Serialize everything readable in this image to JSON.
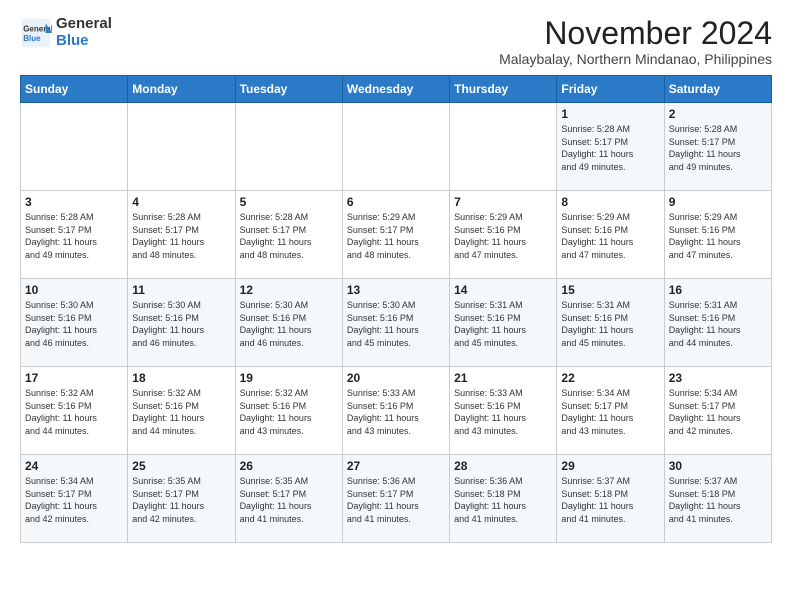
{
  "header": {
    "logo_line1": "General",
    "logo_line2": "Blue",
    "month": "November 2024",
    "location": "Malaybalay, Northern Mindanao, Philippines"
  },
  "days_of_week": [
    "Sunday",
    "Monday",
    "Tuesday",
    "Wednesday",
    "Thursday",
    "Friday",
    "Saturday"
  ],
  "weeks": [
    [
      {
        "day": "",
        "info": ""
      },
      {
        "day": "",
        "info": ""
      },
      {
        "day": "",
        "info": ""
      },
      {
        "day": "",
        "info": ""
      },
      {
        "day": "",
        "info": ""
      },
      {
        "day": "1",
        "info": "Sunrise: 5:28 AM\nSunset: 5:17 PM\nDaylight: 11 hours\nand 49 minutes."
      },
      {
        "day": "2",
        "info": "Sunrise: 5:28 AM\nSunset: 5:17 PM\nDaylight: 11 hours\nand 49 minutes."
      }
    ],
    [
      {
        "day": "3",
        "info": "Sunrise: 5:28 AM\nSunset: 5:17 PM\nDaylight: 11 hours\nand 49 minutes."
      },
      {
        "day": "4",
        "info": "Sunrise: 5:28 AM\nSunset: 5:17 PM\nDaylight: 11 hours\nand 48 minutes."
      },
      {
        "day": "5",
        "info": "Sunrise: 5:28 AM\nSunset: 5:17 PM\nDaylight: 11 hours\nand 48 minutes."
      },
      {
        "day": "6",
        "info": "Sunrise: 5:29 AM\nSunset: 5:17 PM\nDaylight: 11 hours\nand 48 minutes."
      },
      {
        "day": "7",
        "info": "Sunrise: 5:29 AM\nSunset: 5:16 PM\nDaylight: 11 hours\nand 47 minutes."
      },
      {
        "day": "8",
        "info": "Sunrise: 5:29 AM\nSunset: 5:16 PM\nDaylight: 11 hours\nand 47 minutes."
      },
      {
        "day": "9",
        "info": "Sunrise: 5:29 AM\nSunset: 5:16 PM\nDaylight: 11 hours\nand 47 minutes."
      }
    ],
    [
      {
        "day": "10",
        "info": "Sunrise: 5:30 AM\nSunset: 5:16 PM\nDaylight: 11 hours\nand 46 minutes."
      },
      {
        "day": "11",
        "info": "Sunrise: 5:30 AM\nSunset: 5:16 PM\nDaylight: 11 hours\nand 46 minutes."
      },
      {
        "day": "12",
        "info": "Sunrise: 5:30 AM\nSunset: 5:16 PM\nDaylight: 11 hours\nand 46 minutes."
      },
      {
        "day": "13",
        "info": "Sunrise: 5:30 AM\nSunset: 5:16 PM\nDaylight: 11 hours\nand 45 minutes."
      },
      {
        "day": "14",
        "info": "Sunrise: 5:31 AM\nSunset: 5:16 PM\nDaylight: 11 hours\nand 45 minutes."
      },
      {
        "day": "15",
        "info": "Sunrise: 5:31 AM\nSunset: 5:16 PM\nDaylight: 11 hours\nand 45 minutes."
      },
      {
        "day": "16",
        "info": "Sunrise: 5:31 AM\nSunset: 5:16 PM\nDaylight: 11 hours\nand 44 minutes."
      }
    ],
    [
      {
        "day": "17",
        "info": "Sunrise: 5:32 AM\nSunset: 5:16 PM\nDaylight: 11 hours\nand 44 minutes."
      },
      {
        "day": "18",
        "info": "Sunrise: 5:32 AM\nSunset: 5:16 PM\nDaylight: 11 hours\nand 44 minutes."
      },
      {
        "day": "19",
        "info": "Sunrise: 5:32 AM\nSunset: 5:16 PM\nDaylight: 11 hours\nand 43 minutes."
      },
      {
        "day": "20",
        "info": "Sunrise: 5:33 AM\nSunset: 5:16 PM\nDaylight: 11 hours\nand 43 minutes."
      },
      {
        "day": "21",
        "info": "Sunrise: 5:33 AM\nSunset: 5:16 PM\nDaylight: 11 hours\nand 43 minutes."
      },
      {
        "day": "22",
        "info": "Sunrise: 5:34 AM\nSunset: 5:17 PM\nDaylight: 11 hours\nand 43 minutes."
      },
      {
        "day": "23",
        "info": "Sunrise: 5:34 AM\nSunset: 5:17 PM\nDaylight: 11 hours\nand 42 minutes."
      }
    ],
    [
      {
        "day": "24",
        "info": "Sunrise: 5:34 AM\nSunset: 5:17 PM\nDaylight: 11 hours\nand 42 minutes."
      },
      {
        "day": "25",
        "info": "Sunrise: 5:35 AM\nSunset: 5:17 PM\nDaylight: 11 hours\nand 42 minutes."
      },
      {
        "day": "26",
        "info": "Sunrise: 5:35 AM\nSunset: 5:17 PM\nDaylight: 11 hours\nand 41 minutes."
      },
      {
        "day": "27",
        "info": "Sunrise: 5:36 AM\nSunset: 5:17 PM\nDaylight: 11 hours\nand 41 minutes."
      },
      {
        "day": "28",
        "info": "Sunrise: 5:36 AM\nSunset: 5:18 PM\nDaylight: 11 hours\nand 41 minutes."
      },
      {
        "day": "29",
        "info": "Sunrise: 5:37 AM\nSunset: 5:18 PM\nDaylight: 11 hours\nand 41 minutes."
      },
      {
        "day": "30",
        "info": "Sunrise: 5:37 AM\nSunset: 5:18 PM\nDaylight: 11 hours\nand 41 minutes."
      }
    ]
  ]
}
